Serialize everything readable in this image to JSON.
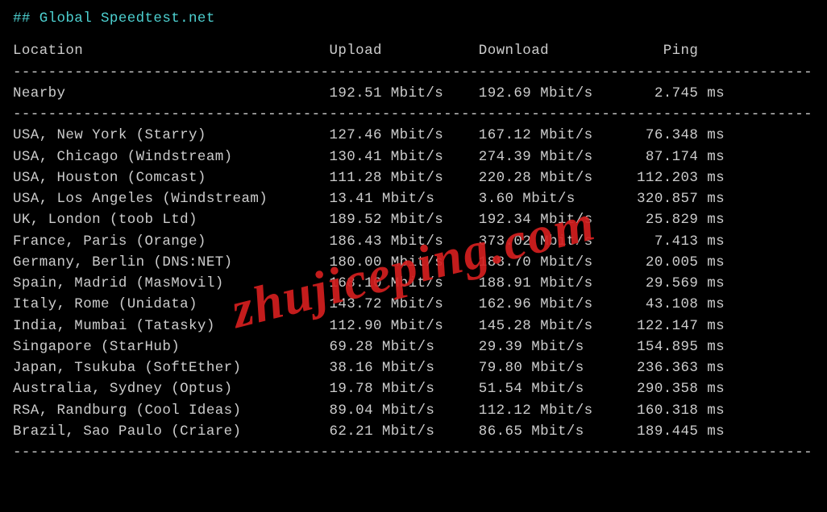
{
  "title": "## Global Speedtest.net",
  "columns": {
    "location": "Location",
    "upload": "Upload",
    "download": "Download",
    "ping": "Ping"
  },
  "nearby": {
    "location": "Nearby",
    "upload": "192.51 Mbit/s",
    "download": "192.69 Mbit/s",
    "ping": "2.745 ms"
  },
  "rows": [
    {
      "location": "USA, New York (Starry)",
      "upload": "127.46 Mbit/s",
      "download": "167.12 Mbit/s",
      "ping": "76.348 ms"
    },
    {
      "location": "USA, Chicago (Windstream)",
      "upload": "130.41 Mbit/s",
      "download": "274.39 Mbit/s",
      "ping": "87.174 ms"
    },
    {
      "location": "USA, Houston (Comcast)",
      "upload": "111.28 Mbit/s",
      "download": "220.28 Mbit/s",
      "ping": "112.203 ms"
    },
    {
      "location": "USA, Los Angeles (Windstream)",
      "upload": "13.41 Mbit/s",
      "download": "3.60 Mbit/s",
      "ping": "320.857 ms"
    },
    {
      "location": "UK, London (toob Ltd)",
      "upload": "189.52 Mbit/s",
      "download": "192.34 Mbit/s",
      "ping": "25.829 ms"
    },
    {
      "location": "France, Paris (Orange)",
      "upload": "186.43 Mbit/s",
      "download": "373.02 Mbit/s",
      "ping": "7.413 ms"
    },
    {
      "location": "Germany, Berlin (DNS:NET)",
      "upload": "180.00 Mbit/s",
      "download": "188.70 Mbit/s",
      "ping": "20.005 ms"
    },
    {
      "location": "Spain, Madrid (MasMovil)",
      "upload": "168.10 Mbit/s",
      "download": "188.91 Mbit/s",
      "ping": "29.569 ms"
    },
    {
      "location": "Italy, Rome (Unidata)",
      "upload": "143.72 Mbit/s",
      "download": "162.96 Mbit/s",
      "ping": "43.108 ms"
    },
    {
      "location": "India, Mumbai (Tatasky)",
      "upload": "112.90 Mbit/s",
      "download": "145.28 Mbit/s",
      "ping": "122.147 ms"
    },
    {
      "location": "Singapore (StarHub)",
      "upload": "69.28 Mbit/s",
      "download": "29.39 Mbit/s",
      "ping": "154.895 ms"
    },
    {
      "location": "Japan, Tsukuba (SoftEther)",
      "upload": "38.16 Mbit/s",
      "download": "79.80 Mbit/s",
      "ping": "236.363 ms"
    },
    {
      "location": "Australia, Sydney (Optus)",
      "upload": "19.78 Mbit/s",
      "download": "51.54 Mbit/s",
      "ping": "290.358 ms"
    },
    {
      "location": "RSA, Randburg (Cool Ideas)",
      "upload": "89.04 Mbit/s",
      "download": "112.12 Mbit/s",
      "ping": "160.318 ms"
    },
    {
      "location": "Brazil, Sao Paulo (Criare)",
      "upload": "62.21 Mbit/s",
      "download": "86.65 Mbit/s",
      "ping": "189.445 ms"
    }
  ],
  "watermark": "zhujiceping.com",
  "divider": "---------------------------------------------------------------------------------------------",
  "chart_data": {
    "type": "table",
    "title": "Global Speedtest.net",
    "columns": [
      "Location",
      "Upload (Mbit/s)",
      "Download (Mbit/s)",
      "Ping (ms)"
    ],
    "rows": [
      [
        "Nearby",
        192.51,
        192.69,
        2.745
      ],
      [
        "USA, New York (Starry)",
        127.46,
        167.12,
        76.348
      ],
      [
        "USA, Chicago (Windstream)",
        130.41,
        274.39,
        87.174
      ],
      [
        "USA, Houston (Comcast)",
        111.28,
        220.28,
        112.203
      ],
      [
        "USA, Los Angeles (Windstream)",
        13.41,
        3.6,
        320.857
      ],
      [
        "UK, London (toob Ltd)",
        189.52,
        192.34,
        25.829
      ],
      [
        "France, Paris (Orange)",
        186.43,
        373.02,
        7.413
      ],
      [
        "Germany, Berlin (DNS:NET)",
        180.0,
        188.7,
        20.005
      ],
      [
        "Spain, Madrid (MasMovil)",
        168.1,
        188.91,
        29.569
      ],
      [
        "Italy, Rome (Unidata)",
        143.72,
        162.96,
        43.108
      ],
      [
        "India, Mumbai (Tatasky)",
        112.9,
        145.28,
        122.147
      ],
      [
        "Singapore (StarHub)",
        69.28,
        29.39,
        154.895
      ],
      [
        "Japan, Tsukuba (SoftEther)",
        38.16,
        79.8,
        236.363
      ],
      [
        "Australia, Sydney (Optus)",
        19.78,
        51.54,
        290.358
      ],
      [
        "RSA, Randburg (Cool Ideas)",
        89.04,
        112.12,
        160.318
      ],
      [
        "Brazil, Sao Paulo (Criare)",
        62.21,
        86.65,
        189.445
      ]
    ]
  }
}
